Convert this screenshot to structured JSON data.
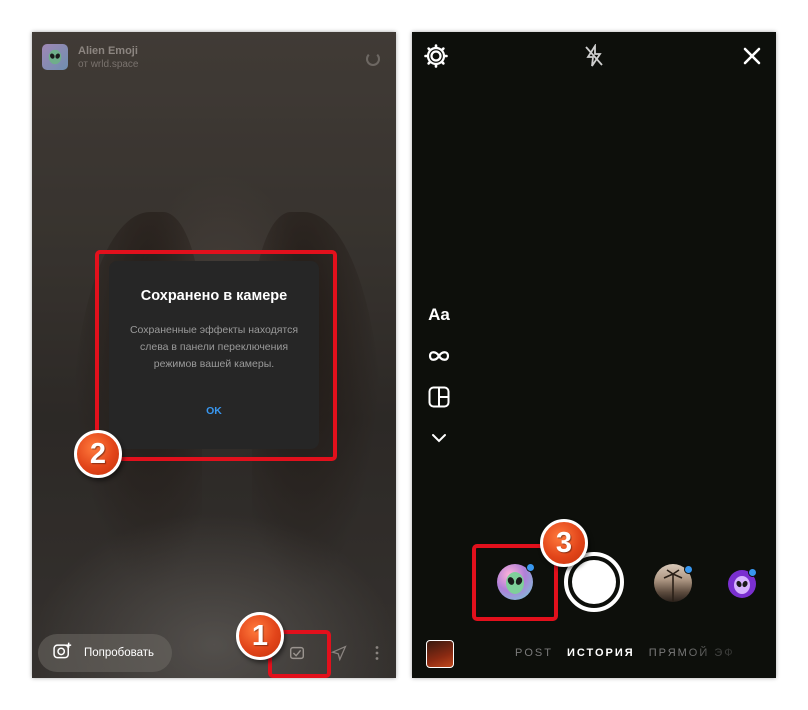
{
  "left_screen": {
    "effect": {
      "name": "Alien Emoji",
      "author": "от wrld.space",
      "icon": "alien-icon"
    },
    "dialog": {
      "title": "Сохранено в камере",
      "body": "Сохраненные эффекты находятся слева в панели переключения режимов вашей камеры.",
      "ok_label": "OK"
    },
    "try_button": {
      "label": "Попробовать",
      "icon": "camera-plus-icon"
    },
    "bottom_icons": [
      "saved-effect-icon",
      "send-icon",
      "more-icon"
    ]
  },
  "right_screen": {
    "top_icons": [
      "settings-icon",
      "flash-off-icon",
      "close-icon"
    ],
    "side_tools": {
      "text_tool": "Aa",
      "icons": [
        "boomerang-icon",
        "layout-icon",
        "chevron-down-icon"
      ]
    },
    "modes": [
      "POST",
      "ИСТОРИЯ",
      "ПРЯМОЙ ЭФ"
    ],
    "active_mode": "ИСТОРИЯ",
    "effects": [
      "alien-emoji-effect",
      "palm-photo-effect",
      "purple-alien-effect"
    ]
  },
  "annotations": {
    "badges": [
      "1",
      "2",
      "3"
    ],
    "highlight_color": "#e2101c",
    "badge_color": "#e2451a"
  },
  "colors": {
    "accent_blue": "#3897f0",
    "dialog_bg": "#262626",
    "camera_bg": "#0d0f0b"
  }
}
